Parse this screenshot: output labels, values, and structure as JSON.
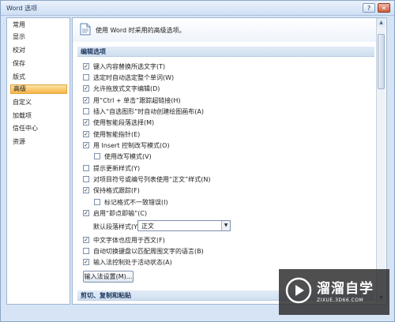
{
  "window": {
    "title": "Word 选项",
    "help_label": "?",
    "close_label": "✕"
  },
  "sidebar": {
    "items": [
      {
        "label": "常用"
      },
      {
        "label": "显示"
      },
      {
        "label": "校对"
      },
      {
        "label": "保存"
      },
      {
        "label": "版式"
      },
      {
        "label": "高级",
        "selected": true
      },
      {
        "label": "自定义"
      },
      {
        "label": "加载项"
      },
      {
        "label": "信任中心"
      },
      {
        "label": "资源"
      }
    ]
  },
  "main": {
    "header": "使用 Word 时采用的高级选项。",
    "section_edit": "编辑选项",
    "options": [
      {
        "label": "键入内容替换所选文字(T)",
        "checked": true
      },
      {
        "label": "选定时自动选定整个单词(W)",
        "checked": false
      },
      {
        "label": "允许拖放式文字编辑(D)",
        "checked": true
      },
      {
        "label": "用“Ctrl + 单击”跟踪超链接(H)",
        "checked": true
      },
      {
        "label": "插入“自选图形”时自动创建绘图画布(A)",
        "checked": false
      },
      {
        "label": "使用智能段落选择(M)",
        "checked": true
      },
      {
        "label": "使用智能指针(E)",
        "checked": true
      },
      {
        "label": "用 Insert 控制改写模式(O)",
        "checked": true
      },
      {
        "label": "使用改写模式(V)",
        "checked": false
      },
      {
        "label": "提示更新样式(Y)",
        "checked": false
      },
      {
        "label": "对项目符号或编号列表使用“正文”样式(N)",
        "checked": false
      },
      {
        "label": "保持格式跟踪(F)",
        "checked": true
      },
      {
        "label": "标记格式不一致错误(I)",
        "checked": false
      },
      {
        "label": "启用“即点即输”(C)",
        "checked": true
      },
      {
        "label": "中文字体也应用于西文(F)",
        "checked": true
      },
      {
        "label": "自动切换键盘以匹配周围文字的语言(B)",
        "checked": false
      },
      {
        "label": "输入法控制处于活动状态(A)",
        "checked": true
      }
    ],
    "default_style_label": "默认段落样式(Y):",
    "default_style_value": "正文",
    "ime_button": "输入法设置(M)...",
    "section_cut": "剪切、复制和粘贴"
  },
  "watermark": {
    "title": "溜溜自学",
    "url": "ZIXUE.3D66.COM"
  },
  "colors": {
    "selected_nav": "#f7b648",
    "section_band": "#cfdff0",
    "window_bg": "#d6e4f5"
  }
}
